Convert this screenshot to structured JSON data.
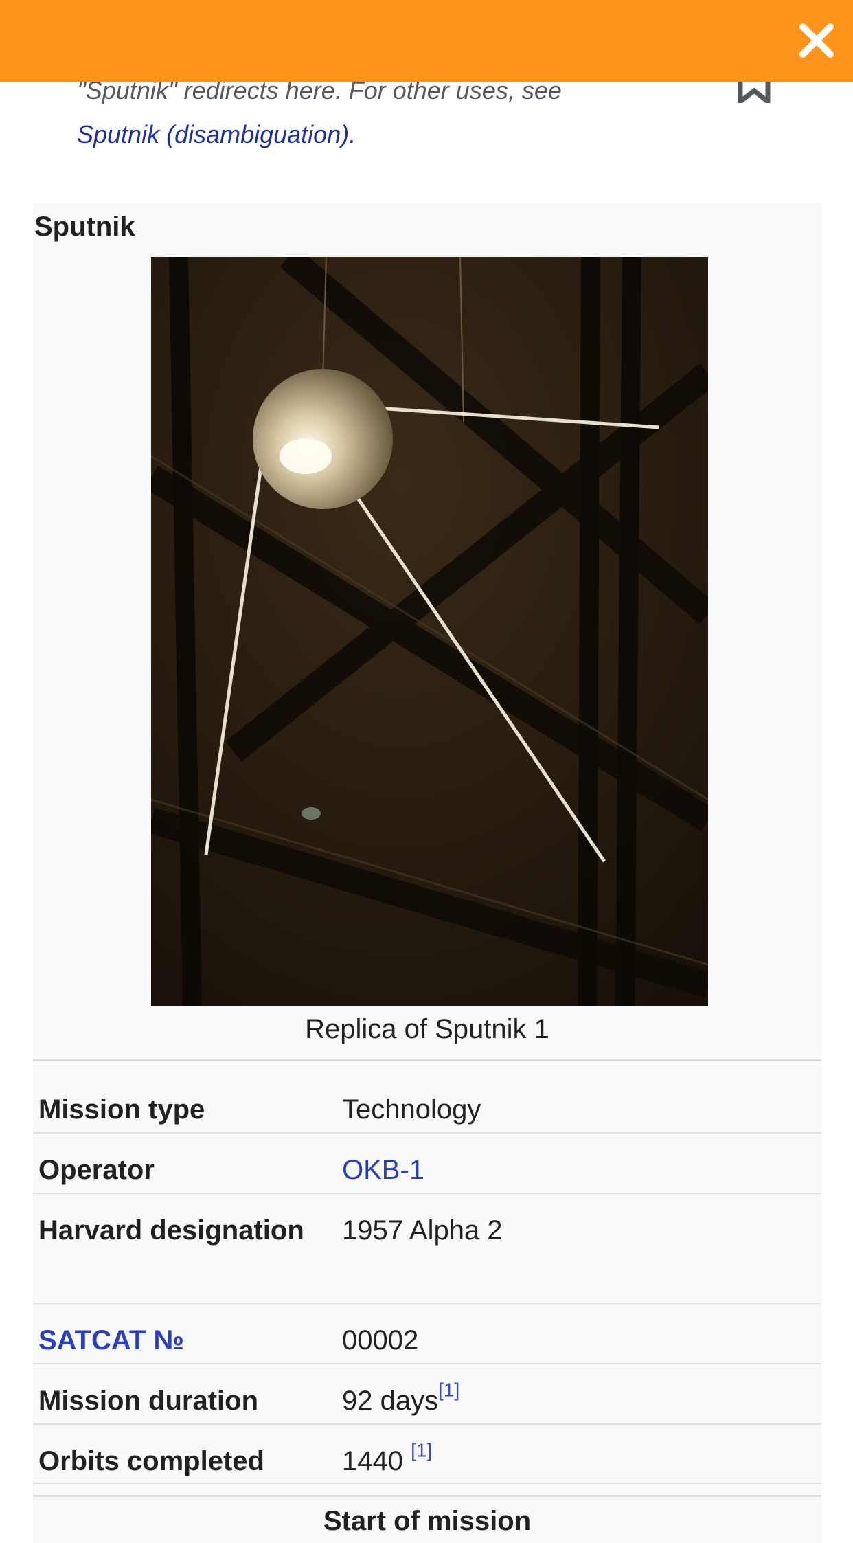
{
  "hatnote": {
    "text": "\"Sputnik\" redirects here. For other uses, see",
    "link": "Sputnik (disambiguation)."
  },
  "infobox": {
    "title": "Sputnik",
    "caption": "Replica of Sputnik 1",
    "rows": [
      {
        "label": "Mission type",
        "value": "Technology"
      },
      {
        "label": "Operator",
        "value": "OKB-1"
      },
      {
        "label": "Harvard designation",
        "value": "1957 Alpha 2"
      },
      {
        "label": "SATCAT №",
        "value": "00002"
      },
      {
        "label": "Mission duration",
        "value": "92 days",
        "ref": "[1]"
      },
      {
        "label": "Orbits completed",
        "value": "1440",
        "ref": "[1]"
      }
    ],
    "next_section": "Start of mission"
  },
  "colors": {
    "topbar": "#ff941c",
    "link": "#2a3fbf",
    "infobox_bg": "#f8f9fa"
  },
  "icons": {
    "close": "close-icon",
    "bookmark": "bookmark-icon"
  }
}
